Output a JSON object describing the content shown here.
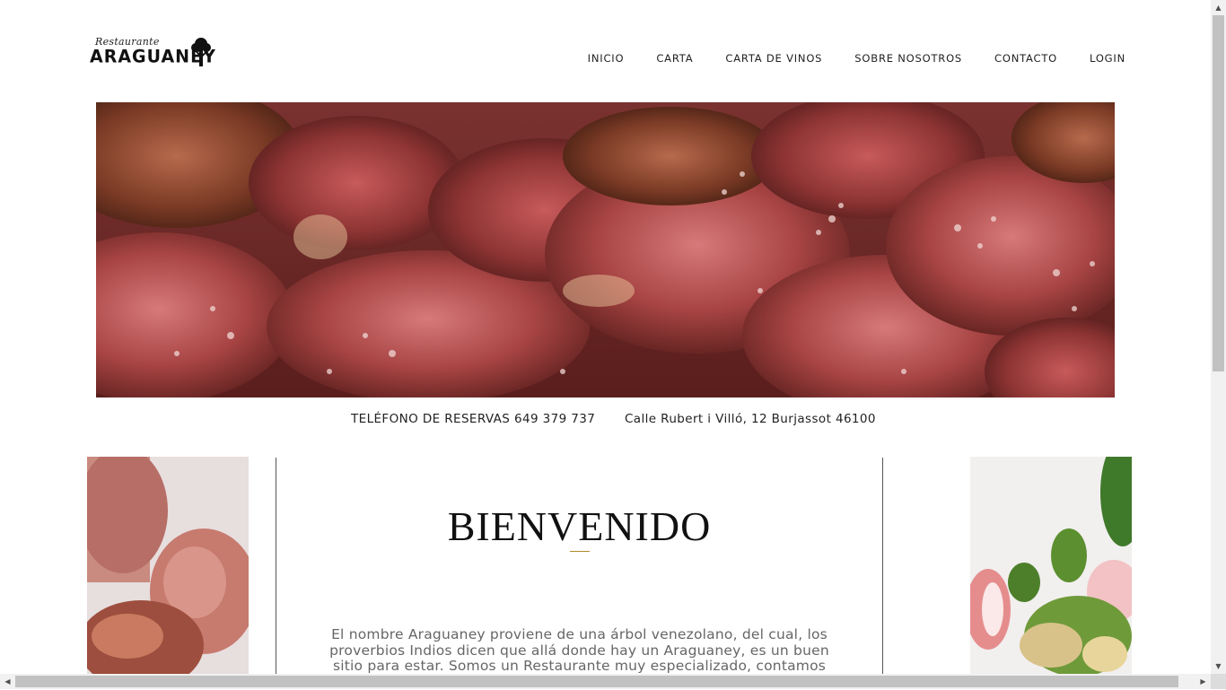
{
  "header": {
    "logo_script": "Restaurante",
    "logo_brand": "ARAGUANEY",
    "nav": [
      "INICIO",
      "CARTA",
      "CARTA DE VINOS",
      "SOBRE NOSOTROS",
      "CONTACTO",
      "LOGIN"
    ]
  },
  "info": {
    "phone_label": "TELÉFONO DE RESERVAS 649 379 737",
    "address": "Calle Rubert i Villó, 12 Burjassot 46100"
  },
  "welcome": {
    "title": "BIENVENIDO",
    "text": "El nombre Araguaney proviene de una árbol venezolano, del cual, los proverbios Indios dicen que allá donde hay un Araguaney, es un buen sitio para estar. Somos un Restaurante muy especializado, contamos con"
  },
  "colors": {
    "accent_underline": "#b08a2e",
    "text": "#222222",
    "paragraph": "#666666"
  },
  "scrollbar": {
    "up_arrow": "▲",
    "down_arrow": "▼",
    "left_arrow": "◀",
    "right_arrow": "▶"
  }
}
